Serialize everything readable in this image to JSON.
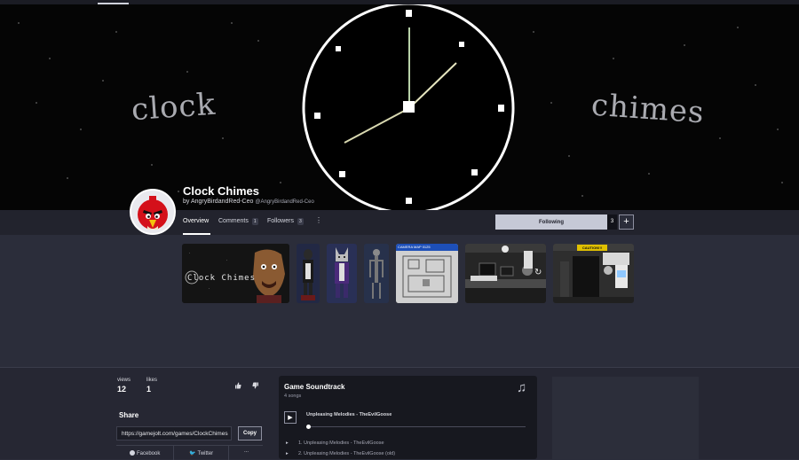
{
  "game": {
    "title": "Clock Chimes",
    "by_prefix": "by",
    "developer_name": "AngryBirdandRed-Ceo",
    "developer_handle": "@AngryBirdandRed-Ceo"
  },
  "banner": {
    "left_word": "clock",
    "right_word": "chimes"
  },
  "tabs": [
    {
      "label": "Overview",
      "count": ""
    },
    {
      "label": "Comments",
      "count": "1"
    },
    {
      "label": "Followers",
      "count": "3"
    }
  ],
  "more_icon": "⋮",
  "follow": {
    "label": "Following",
    "count": "3",
    "add_label": "+"
  },
  "media": {
    "first_thumb_text": "Clock Chimes",
    "cctv_window_title": "CAMERA MAP 0125",
    "caution_sign": "CAUTION!!!",
    "refresh_icon": "↻"
  },
  "stats": {
    "views_label": "views",
    "views_value": "12",
    "likes_label": "likes",
    "likes_value": "1"
  },
  "share": {
    "title": "Share",
    "url": "https://gamejolt.com/games/ClockChimes",
    "copy_label": "Copy",
    "facebook_label": "Facebook",
    "twitter_label": "Twitter",
    "more_label": "..."
  },
  "soundtrack": {
    "title": "Game Soundtrack",
    "count_text": "4 songs",
    "music_icon": "♫",
    "play_icon": "▶",
    "now_playing": "Unpleasing Melodies - TheEvilGoose",
    "songs": [
      "1.  Unpleasing Melodies - TheEvilGoose",
      "2.  Unpleasing Melodies - TheEvilGoose (old)"
    ]
  },
  "icons": {
    "thumbs_up": "thumbs-up-icon",
    "thumbs_down": "thumbs-down-icon",
    "facebook": "facebook-icon",
    "twitter": "twitter-icon"
  }
}
